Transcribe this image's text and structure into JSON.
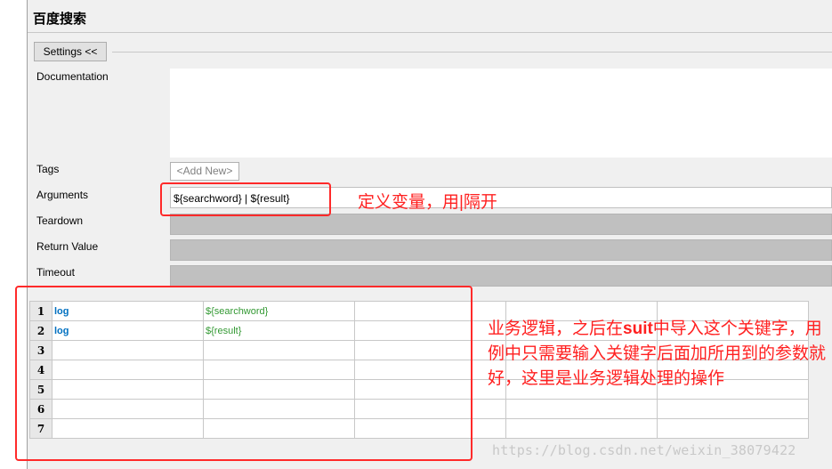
{
  "title": "百度搜索",
  "settings_button": "Settings <<",
  "labels": {
    "documentation": "Documentation",
    "tags": "Tags",
    "arguments": "Arguments",
    "teardown": "Teardown",
    "return_value": "Return Value",
    "timeout": "Timeout"
  },
  "tags_add_new": "<Add New>",
  "arguments_value": "${searchword} | ${result}",
  "grid": {
    "rows": [
      {
        "num": "1",
        "keyword": "log",
        "arg": "${searchword}"
      },
      {
        "num": "2",
        "keyword": "log",
        "arg": "${result}"
      },
      {
        "num": "3",
        "keyword": "",
        "arg": ""
      },
      {
        "num": "4",
        "keyword": "",
        "arg": ""
      },
      {
        "num": "5",
        "keyword": "",
        "arg": ""
      },
      {
        "num": "6",
        "keyword": "",
        "arg": ""
      },
      {
        "num": "7",
        "keyword": "",
        "arg": ""
      }
    ]
  },
  "annotations": {
    "arguments_note": "定义变量，用|隔开",
    "grid_note_part1": "业务逻辑，之后在",
    "grid_note_bold": "suit",
    "grid_note_part2": "中导入这个关键字，用例中只需要输入关键字后面加所用到的参数就好，这里是业务逻辑处理的操作"
  },
  "watermark": "https://blog.csdn.net/weixin_38079422",
  "colors": {
    "annotation_red": "#ff2a2a",
    "keyword_blue": "#0070c0",
    "argument_green": "#339933"
  }
}
